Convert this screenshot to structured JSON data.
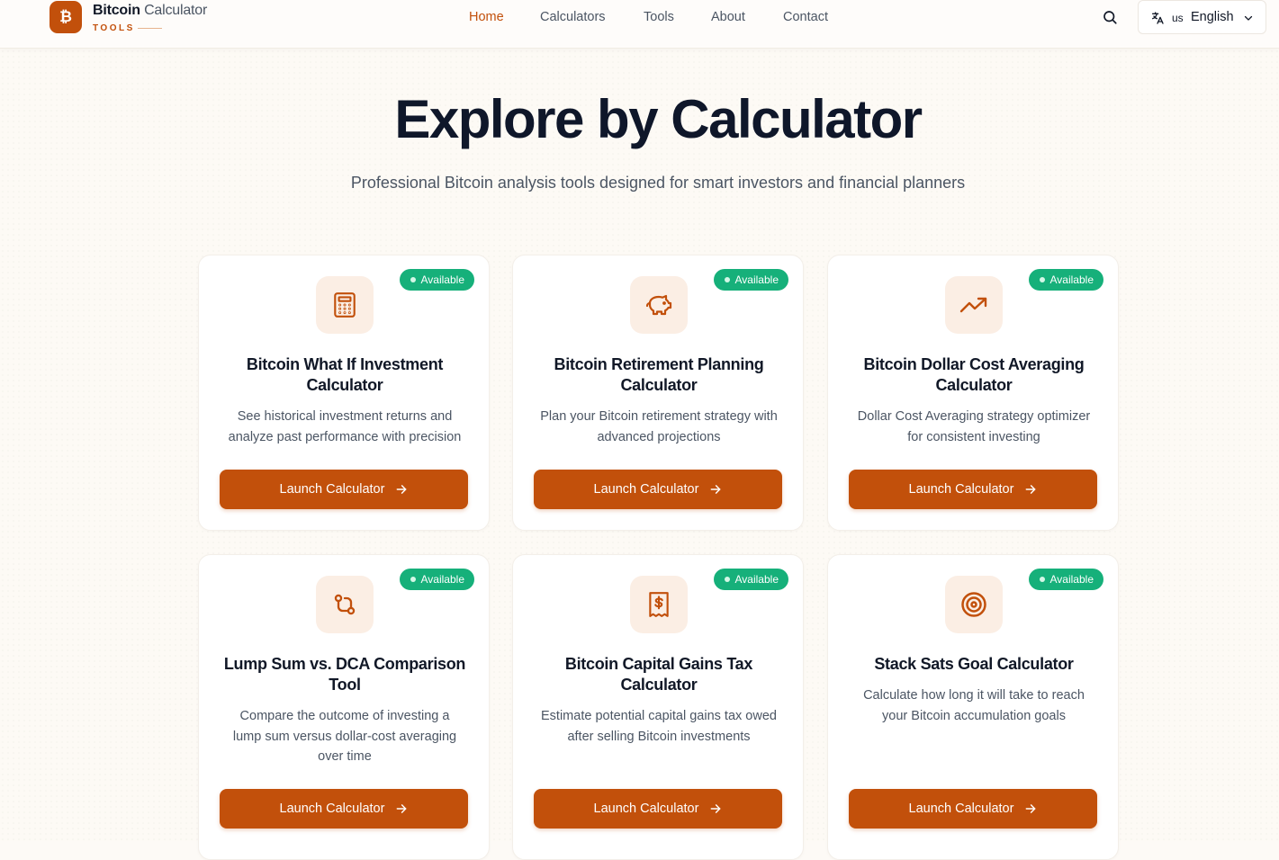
{
  "header": {
    "logo_glyph": "₿",
    "brand_bold": "Bitcoin",
    "brand_rest": "Calculator",
    "brand_sub": "TOOLS",
    "nav": [
      {
        "label": "Home",
        "active": true
      },
      {
        "label": "Calculators",
        "active": false
      },
      {
        "label": "Tools",
        "active": false
      },
      {
        "label": "About",
        "active": false
      },
      {
        "label": "Contact",
        "active": false
      }
    ],
    "lang_code": "us",
    "lang_name": "English"
  },
  "hero": {
    "title": "Explore by Calculator",
    "subtitle": "Professional Bitcoin analysis tools designed for smart investors and financial planners"
  },
  "colors": {
    "accent": "#c2500b",
    "badge": "#16b07a",
    "icon_tile": "#fbeee4"
  },
  "cards": [
    {
      "badge": "Available",
      "icon": "calculator-icon",
      "title_lines": [
        "Bitcoin What If Investment",
        "Calculator"
      ],
      "desc_lines": [
        "See historical investment returns and",
        "analyze past performance with precision"
      ],
      "button": "Launch Calculator"
    },
    {
      "badge": "Available",
      "icon": "piggy-bank-icon",
      "title_lines": [
        "Bitcoin Retirement Planning",
        "Calculator"
      ],
      "desc_lines": [
        "Plan your Bitcoin retirement strategy with",
        "advanced projections"
      ],
      "button": "Launch Calculator"
    },
    {
      "badge": "Available",
      "icon": "trending-up-icon",
      "title_lines": [
        "Bitcoin Dollar Cost Averaging",
        "Calculator"
      ],
      "desc_lines": [
        "Dollar Cost Averaging strategy optimizer",
        "for consistent investing"
      ],
      "button": "Launch Calculator"
    },
    {
      "badge": "Available",
      "icon": "git-compare-icon",
      "title_lines": [
        "Lump Sum vs. DCA Comparison",
        "Tool"
      ],
      "desc_lines": [
        "Compare the outcome of investing a",
        "lump sum versus dollar-cost averaging",
        "over time"
      ],
      "button": "Launch Calculator"
    },
    {
      "badge": "Available",
      "icon": "receipt-dollar-icon",
      "title_lines": [
        "Bitcoin Capital Gains Tax",
        "Calculator"
      ],
      "desc_lines": [
        "Estimate potential capital gains tax owed",
        "after selling Bitcoin investments"
      ],
      "button": "Launch Calculator"
    },
    {
      "badge": "Available",
      "icon": "target-icon",
      "title_lines": [
        "Stack Sats Goal Calculator"
      ],
      "desc_lines": [
        "Calculate how long it will take to reach",
        "your Bitcoin accumulation goals"
      ],
      "button": "Launch Calculator"
    }
  ]
}
